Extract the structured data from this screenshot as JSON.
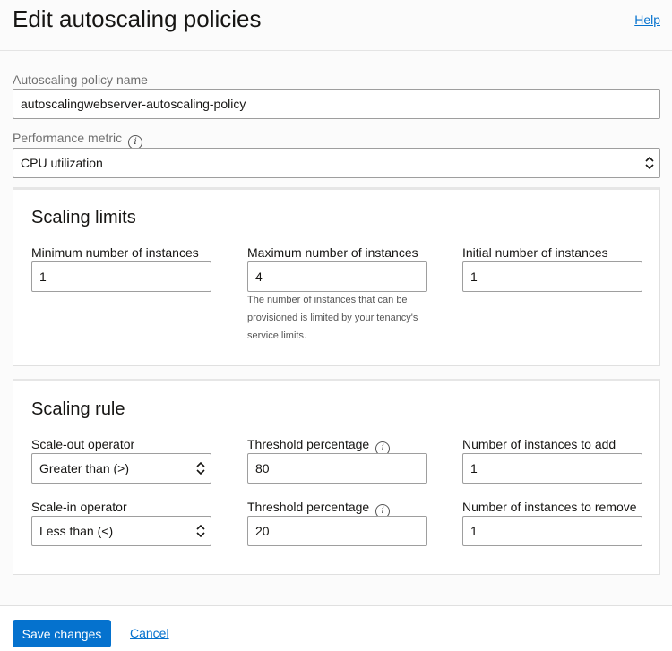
{
  "page": {
    "title": "Edit autoscaling policies",
    "help_label": "Help"
  },
  "policy": {
    "name_label": "Autoscaling policy name",
    "name_value": "autoscalingwebserver-autoscaling-policy",
    "metric_label": "Performance metric",
    "metric_value": "CPU utilization"
  },
  "scaling_limits": {
    "title": "Scaling limits",
    "min_label": "Minimum number of instances",
    "min_value": "1",
    "max_label": "Maximum number of instances",
    "max_value": "4",
    "max_hint": "The number of instances that can be provisioned is limited by your tenancy's service limits.",
    "initial_label": "Initial number of instances",
    "initial_value": "1"
  },
  "scaling_rule": {
    "title": "Scaling rule",
    "out_operator_label": "Scale-out operator",
    "out_operator_value": "Greater than (>)",
    "out_threshold_label": "Threshold percentage",
    "out_threshold_value": "80",
    "add_label": "Number of instances to add",
    "add_value": "1",
    "in_operator_label": "Scale-in operator",
    "in_operator_value": "Less than (<)",
    "in_threshold_label": "Threshold percentage",
    "in_threshold_value": "20",
    "remove_label": "Number of instances to remove",
    "remove_value": "1"
  },
  "footer": {
    "save_label": "Save changes",
    "cancel_label": "Cancel"
  },
  "icons": {
    "info": "info-icon",
    "select": "chevron-updown-icon"
  },
  "colors": {
    "accent": "#0572ce",
    "panel_border": "#e0e0e0",
    "background": "#fbfbfb"
  }
}
